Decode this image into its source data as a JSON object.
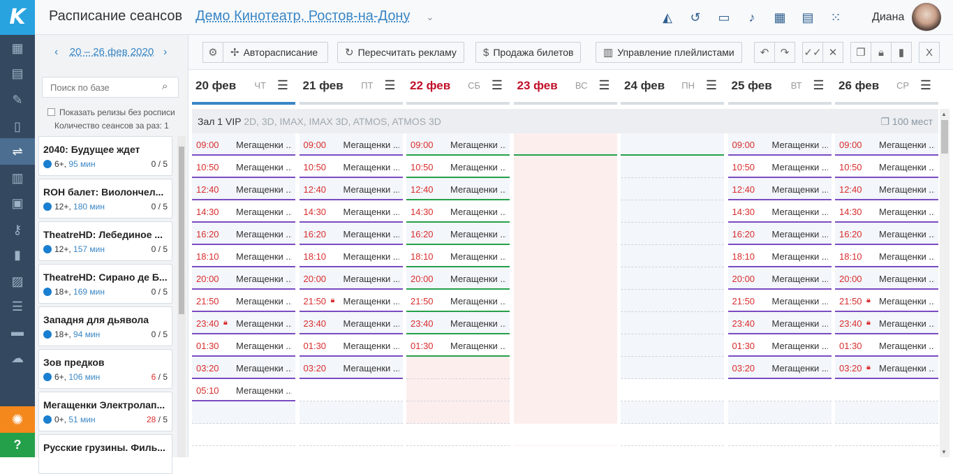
{
  "app": {
    "logo": "K"
  },
  "header": {
    "title": "Расписание сеансов",
    "cinema": "Демо Кинотеатр, Ростов-на-Дону",
    "user": "Диана"
  },
  "side": {
    "date_range": "20 – 26 фев 2020",
    "search_placeholder": "Поиск по базе",
    "show_releases": "Показать релизы без росписи",
    "sessions_per_time": "Количество сеансов за раз: 1",
    "movies": [
      {
        "title": "2040: Будущее ждет",
        "age": "6+,",
        "duration": "95 мин",
        "used": "0",
        "total": "/ 5"
      },
      {
        "title": "ROH балет: Виолончел...",
        "age": "12+,",
        "duration": "180 мин",
        "used": "0",
        "total": "/ 5"
      },
      {
        "title": "TheatreHD: Лебединое ...",
        "age": "12+,",
        "duration": "157 мин",
        "used": "0",
        "total": "/ 5"
      },
      {
        "title": "TheatreHD: Сирано де Б...",
        "age": "18+,",
        "duration": "169 мин",
        "used": "0",
        "total": "/ 5"
      },
      {
        "title": "Западня для дьявола",
        "age": "18+,",
        "duration": "94 мин",
        "used": "0",
        "total": "/ 5"
      },
      {
        "title": "Зов предков",
        "age": "6+,",
        "duration": "106 мин",
        "used": "6",
        "total": "/ 5"
      },
      {
        "title": "Мегащенки Электролап...",
        "age": "0+,",
        "duration": "51 мин",
        "used": "28",
        "total": "/ 5"
      },
      {
        "title": "Русские грузины. Филь...",
        "age": "",
        "duration": "",
        "used": "",
        "total": ""
      }
    ]
  },
  "toolbar": {
    "autoschedule": "Авторасписание",
    "recalc_ads": "Пересчитать рекламу",
    "ticket_sales": "Продажа билетов",
    "playlists": "Управление плейлистами"
  },
  "days": [
    {
      "date": "20 фев",
      "weekday": "ЧТ",
      "holiday": false
    },
    {
      "date": "21 фев",
      "weekday": "ПТ",
      "holiday": false
    },
    {
      "date": "22 фев",
      "weekday": "СБ",
      "holiday": true
    },
    {
      "date": "23 фев",
      "weekday": "ВС",
      "holiday": true
    },
    {
      "date": "24 фев",
      "weekday": "ПН",
      "holiday": false
    },
    {
      "date": "25 фев",
      "weekday": "ВТ",
      "holiday": false
    },
    {
      "date": "26 фев",
      "weekday": "СР",
      "holiday": false
    }
  ],
  "hall": {
    "name": "Зал 1 VIP",
    "formats": "2D, 3D, IMAX, IMAX 3D, ATMOS, ATMOS 3D",
    "seats": "100 мест"
  },
  "movie_short": "Мегащенки ...",
  "schedule": [
    {
      "times": [
        "09:00",
        "10:50",
        "12:40",
        "14:30",
        "16:20",
        "18:10",
        "20:00",
        "21:50",
        "23:40",
        "01:30",
        "03:20",
        "05:10"
      ],
      "locked": [
        false,
        false,
        false,
        false,
        false,
        false,
        false,
        false,
        true,
        false,
        false,
        false
      ]
    },
    {
      "times": [
        "09:00",
        "10:50",
        "12:40",
        "14:30",
        "16:20",
        "18:10",
        "20:00",
        "21:50",
        "23:40",
        "01:30",
        "03:20"
      ],
      "locked": [
        false,
        false,
        false,
        false,
        false,
        false,
        false,
        true,
        false,
        false,
        false
      ]
    },
    {
      "times": [
        "09:00",
        "10:50",
        "12:40",
        "14:30",
        "16:20",
        "18:10",
        "20:00",
        "21:50",
        "23:40",
        "01:30"
      ],
      "locked": [
        false,
        false,
        false,
        false,
        false,
        false,
        false,
        false,
        false,
        false
      ]
    },
    {
      "times": [],
      "locked": []
    },
    {
      "times": [],
      "locked": []
    },
    {
      "times": [
        "09:00",
        "10:50",
        "12:40",
        "14:30",
        "16:20",
        "18:10",
        "20:00",
        "21:50",
        "23:40",
        "01:30",
        "03:20"
      ],
      "locked": [
        false,
        false,
        false,
        false,
        false,
        false,
        false,
        false,
        false,
        false,
        false
      ]
    },
    {
      "times": [
        "09:00",
        "10:50",
        "12:40",
        "14:30",
        "16:20",
        "18:10",
        "20:00",
        "21:50",
        "23:40",
        "01:30",
        "03:20"
      ],
      "locked": [
        false,
        false,
        false,
        false,
        false,
        false,
        false,
        true,
        true,
        false,
        true
      ]
    }
  ],
  "colors": {
    "accent": "#3a86c4",
    "session_line": "#7a4bc2",
    "green_line": "#25a04a",
    "time_red": "#d92d2d",
    "holiday": "#c0102a"
  }
}
